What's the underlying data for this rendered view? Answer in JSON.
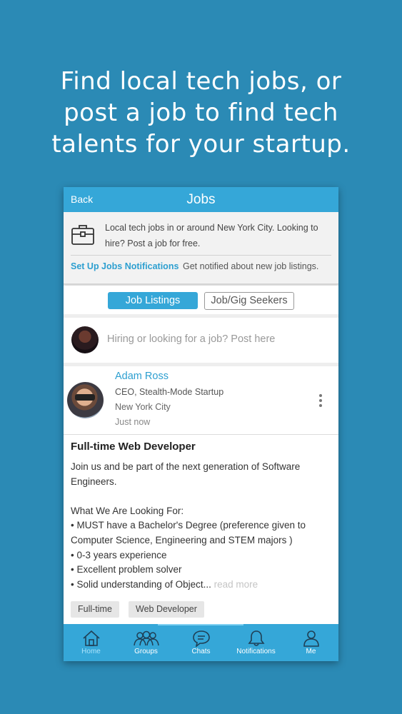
{
  "headline": {
    "line1": "Find local tech jobs, or",
    "line2": "post a job to find tech",
    "line3": "talents for your startup."
  },
  "navbar": {
    "back_label": "Back",
    "title": "Jobs"
  },
  "info": {
    "description": "Local tech jobs in or around New York City. Looking to hire? Post a job for free.",
    "notif_link": "Set Up Jobs Notifications",
    "notif_text": "Get notified about new job listings."
  },
  "tabs": [
    {
      "label": "Job Listings",
      "active": true
    },
    {
      "label": "Job/Gig Seekers",
      "active": false
    }
  ],
  "composer": {
    "placeholder": "Hiring or looking for a job? Post here"
  },
  "post": {
    "author": "Adam Ross",
    "role": "CEO, Stealth-Mode Startup",
    "location": "New York City",
    "time": "Just now",
    "title": "Full-time Web Developer",
    "body": {
      "l1": "Join us and be part of the next generation of Software",
      "l2": "Engineers.",
      "l3": "What We Are Looking For:",
      "l4": "• MUST have a Bachelor's Degree (preference given to",
      "l5": "Computer Science, Engineering and STEM majors )",
      "l6": "• 0-3 years experience",
      "l7": "• Excellent problem solver",
      "l8": "• Solid understanding of Object..."
    },
    "read_more": "read more",
    "tags": [
      "Full-time",
      "Web Developer"
    ]
  },
  "bottom_nav": [
    {
      "label": "Home",
      "icon": "home-icon",
      "active": true
    },
    {
      "label": "Groups",
      "icon": "groups-icon",
      "active": false
    },
    {
      "label": "Chats",
      "icon": "chat-icon",
      "active": false
    },
    {
      "label": "Notifications",
      "icon": "bell-icon",
      "active": false
    },
    {
      "label": "Me",
      "icon": "user-icon",
      "active": false
    }
  ],
  "colors": {
    "background": "#2b8ab5",
    "accent": "#35a7d8",
    "link": "#2d9fd0"
  }
}
